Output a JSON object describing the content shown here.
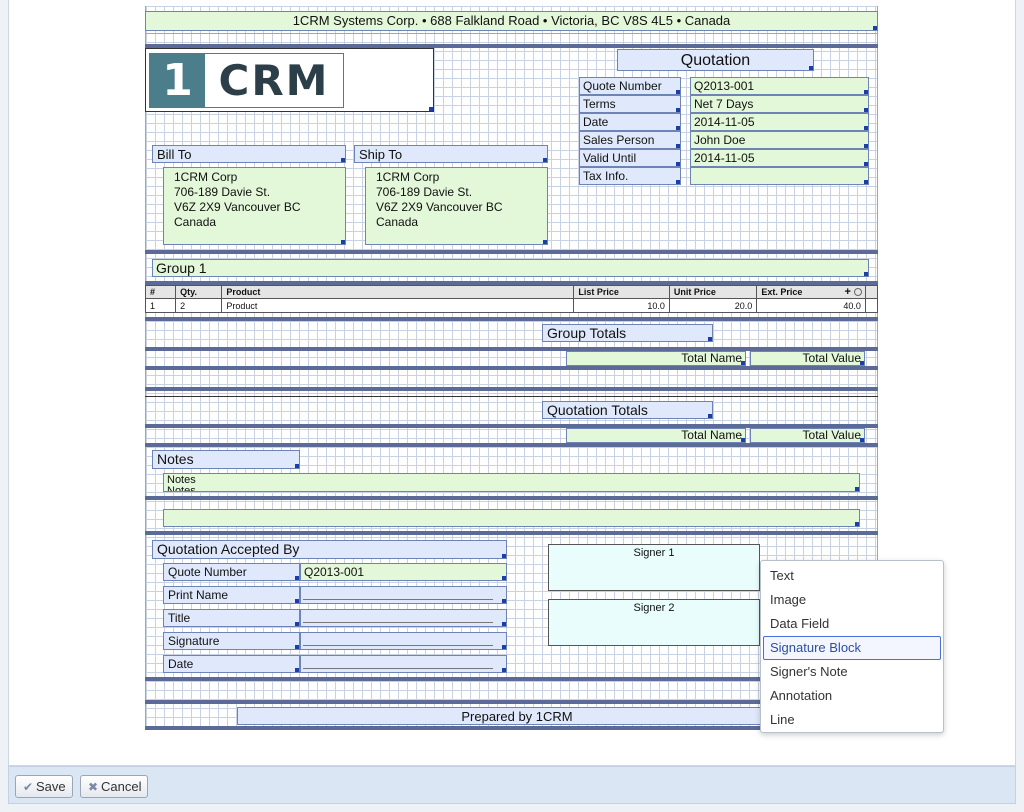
{
  "header": {
    "company_line": "1CRM Systems Corp. • 688 Falkland Road • Victoria, BC V8S 4L5 • Canada"
  },
  "logo": {
    "text_one": "1",
    "text_crm": "CRM"
  },
  "quote": {
    "title": "Quotation",
    "fields": [
      {
        "label": "Quote Number",
        "value": "Q2013-001"
      },
      {
        "label": "Terms",
        "value": "Net 7 Days"
      },
      {
        "label": "Date",
        "value": "2014-11-05"
      },
      {
        "label": "Sales Person",
        "value": "John Doe"
      },
      {
        "label": "Valid Until",
        "value": "2014-11-05"
      },
      {
        "label": "Tax Info.",
        "value": ""
      }
    ]
  },
  "bill_to": {
    "label": "Bill To",
    "lines": [
      "1CRM Corp",
      "706-189 Davie St.",
      "V6Z 2X9 Vancouver BC",
      "Canada"
    ]
  },
  "ship_to": {
    "label": "Ship To",
    "lines": [
      "1CRM Corp",
      "706-189 Davie St.",
      "V6Z 2X9 Vancouver BC",
      "Canada"
    ]
  },
  "group": {
    "label": "Group 1"
  },
  "product_table": {
    "headers": [
      "#",
      "Qty.",
      "Product",
      "List Price",
      "Unit Price",
      "Ext. Price"
    ],
    "rows": [
      [
        "1",
        "2",
        "Product",
        "10.0",
        "20.0",
        "40.0"
      ]
    ],
    "add_symbol": "+"
  },
  "group_totals": {
    "label": "Group Totals",
    "total_name": "Total Name",
    "total_value": "Total Value"
  },
  "quotation_totals": {
    "label": "Quotation Totals",
    "total_name": "Total Name",
    "total_value": "Total Value"
  },
  "notes": {
    "label": "Notes",
    "field": "Notes",
    "field_overflow": "Notes"
  },
  "accepted": {
    "title": "Quotation Accepted By",
    "rows": [
      {
        "label": "Quote Number",
        "value": "Q2013-001"
      },
      {
        "label": "Print Name",
        "value": ""
      },
      {
        "label": "Title",
        "value": ""
      },
      {
        "label": "Signature",
        "value": ""
      },
      {
        "label": "Date",
        "value": ""
      }
    ]
  },
  "signers": {
    "signer1": "Signer 1",
    "signer2": "Signer 2"
  },
  "footer": {
    "prepared_by": "Prepared by 1CRM"
  },
  "context_menu": {
    "items": [
      "Text",
      "Image",
      "Data Field",
      "Signature Block",
      "Signer's Note",
      "Annotation",
      "Line"
    ],
    "highlighted": "Signature Block"
  },
  "buttons": {
    "save": "Save",
    "cancel": "Cancel"
  },
  "colors": {
    "label_bg": "#dfe9fb",
    "field_bg": "#e3f7d9",
    "signer_bg": "#e8fdfc",
    "band": "#5b6a97",
    "logo_teal": "#4c7d8b"
  }
}
